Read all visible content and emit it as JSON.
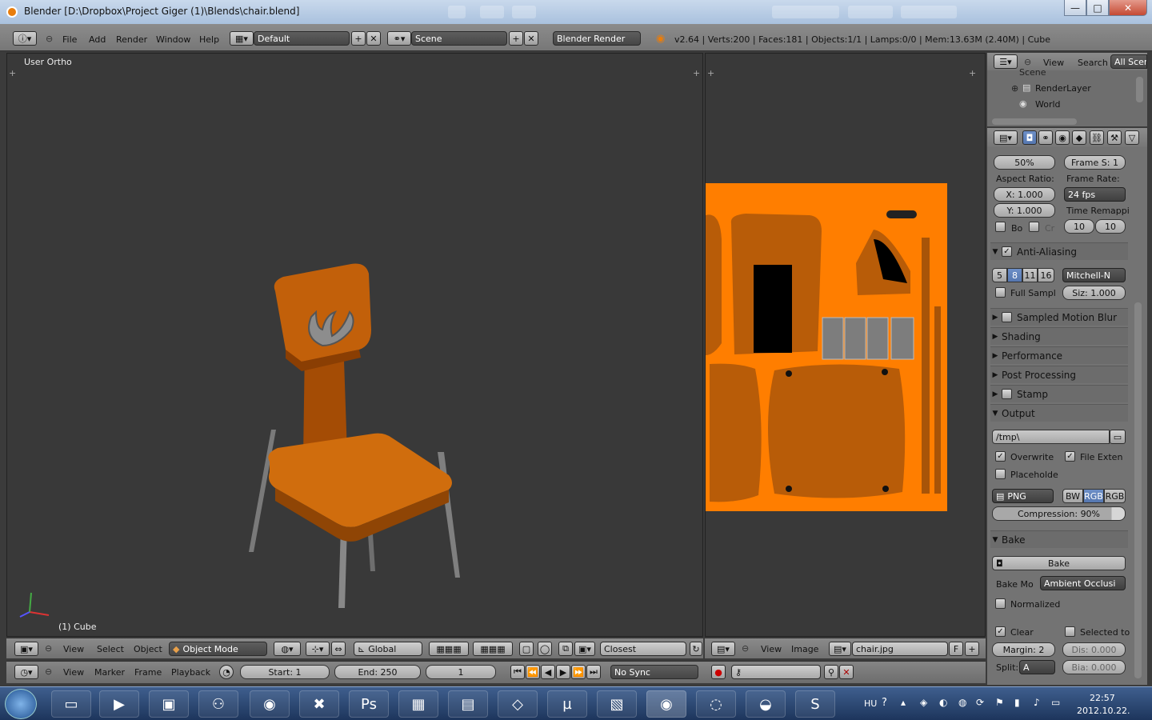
{
  "window": {
    "title": "Blender [D:\\Dropbox\\Project Giger (1)\\Blends\\chair.blend]",
    "controls": {
      "minimize": "—",
      "maximize": "□",
      "close": "✕"
    }
  },
  "info_header": {
    "menus": [
      "File",
      "Add",
      "Render",
      "Window",
      "Help"
    ],
    "screen_layout": "Default",
    "scene": "Scene",
    "engine": "Blender Render",
    "stats": "v2.64 | Verts:200 | Faces:181 | Objects:1/1 | Lamps:0/0 | Mem:13.63M (2.40M) | Cube"
  },
  "viewport": {
    "view_label": "User Ortho",
    "object_label": "(1) Cube",
    "header_menus": [
      "View",
      "Select",
      "Object"
    ],
    "mode": "Object Mode",
    "orientation": "Global",
    "snap": "Closest"
  },
  "timeline": {
    "menus": [
      "View",
      "Marker",
      "Frame",
      "Playback"
    ],
    "start": "Start: 1",
    "end": "End: 250",
    "current": "1",
    "sync": "No Sync"
  },
  "uv_editor": {
    "menus": [
      "View",
      "Image"
    ],
    "image_name": "chair.jpg",
    "fake_user": "F",
    "texture_color": "#ff7e00"
  },
  "outliner": {
    "menus": [
      "View",
      "Search"
    ],
    "filter": "All Scen",
    "items": [
      "Scene",
      "RenderLayer",
      "World"
    ]
  },
  "properties": {
    "resolution_pct": "50%",
    "frame_step": "Frame S: 1",
    "aspect_label": "Aspect Ratio:",
    "framerate_label": "Frame Rate:",
    "aspect_x": "X: 1.000",
    "aspect_y": "Y: 1.000",
    "fps": "24 fps",
    "time_remap_label": "Time Remappi",
    "border": "Bo",
    "crop": "Cr",
    "remap_old": "10",
    "remap_new": "10",
    "aa_title": "Anti-Aliasing",
    "aa_samples": [
      "5",
      "8",
      "11",
      "16"
    ],
    "aa_filter": "Mitchell-N",
    "full_sample": "Full Sampl",
    "filter_size": "Siz: 1.000",
    "panels": {
      "motion_blur": "Sampled Motion Blur",
      "shading": "Shading",
      "performance": "Performance",
      "post_processing": "Post Processing",
      "stamp": "Stamp",
      "output": "Output",
      "bake": "Bake"
    },
    "output_path": "/tmp\\",
    "overwrite": "Overwrite",
    "file_ext": "File Exten",
    "placeholders": "Placeholde",
    "format": "PNG",
    "color_modes": [
      "BW",
      "RGB",
      "RGB"
    ],
    "compression": "Compression: 90%",
    "bake_button": "Bake",
    "bake_mode_label": "Bake Mo",
    "bake_mode": "Ambient Occlusi",
    "normalized": "Normalized",
    "clear": "Clear",
    "selected_to_active": "Selected to",
    "margin": "Margin: 2",
    "distance": "Dis: 0.000",
    "split_label": "Split:",
    "split_value": "A",
    "bias": "Bia: 0.000"
  },
  "taskbar": {
    "lang": "HU",
    "time": "22:57",
    "date": "2012.10.22."
  }
}
